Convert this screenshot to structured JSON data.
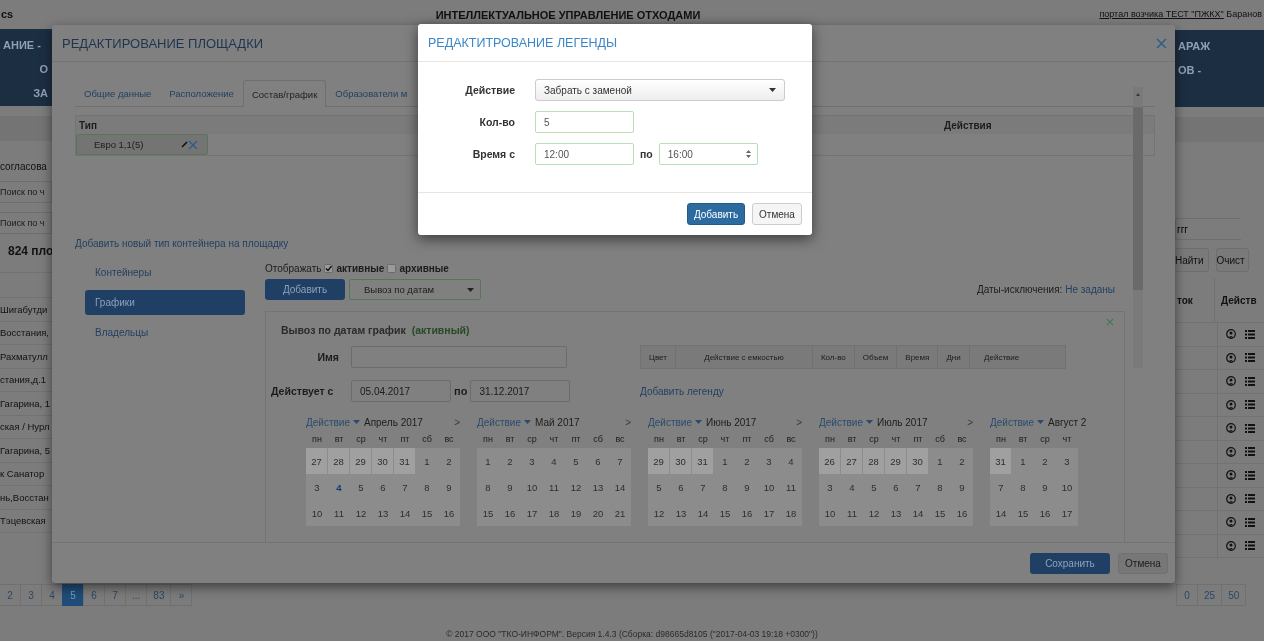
{
  "background": {
    "header": {
      "logo": "cs",
      "title": "ИНТЕЛЛЕКТУАЛЬНОЕ УПРАВЛЕНИЕ ОТХОДАМИ",
      "portal_link": "портал возчика ТЕСТ \"ПЖКХ\"",
      "user": "Баранов"
    },
    "nav_left": [
      "АНИЕ -",
      "О",
      "ЗА"
    ],
    "nav_right": [
      "АРАЖ",
      "ОВ -"
    ],
    "status_text": "согласова",
    "search_fields": [
      {
        "placeholder": "Поиск по ч"
      },
      {
        "placeholder": "Поиск по ч"
      }
    ],
    "count": "824 пло",
    "search_right": {
      "value": "ггг"
    },
    "buttons_right": [
      "Найти",
      "Очист"
    ],
    "columns_right": [
      "ток",
      "Действ"
    ],
    "rows": [
      "Шигабутди",
      "Восстания,",
      "Рахматулл",
      "стания,д.1",
      "Гагарина, 1",
      "ская / Нурл",
      "Гагарина, 5",
      "к Санатор",
      "нь,Восстан",
      "Тэцевская"
    ],
    "pagination": [
      {
        "label": "2",
        "selected": false
      },
      {
        "label": "3",
        "selected": false
      },
      {
        "label": "4",
        "selected": false
      },
      {
        "label": "5",
        "selected": true
      },
      {
        "label": "6",
        "selected": false
      },
      {
        "label": "7",
        "selected": false
      },
      {
        "label": "...",
        "selected": false
      },
      {
        "label": "83",
        "selected": false
      },
      {
        "label": "»",
        "selected": false
      }
    ],
    "page_sizes": [
      "0",
      "25",
      "50"
    ],
    "footer": "© 2017 ООО \"ТКО-ИНФОРМ\". Версия 1.4.3 (Сборка: d98665d8105 (\"2017-04-03 19:18 +0300\"))"
  },
  "site_modal": {
    "title": "РЕДАКТИРОВАНИЕ ПЛОЩАДКИ",
    "tabs": [
      {
        "label": "Общие данные",
        "selected": false
      },
      {
        "label": "Расположение",
        "selected": false
      },
      {
        "label": "Состав/график",
        "selected": true
      },
      {
        "label": "Образователи м",
        "selected": false
      }
    ],
    "container_table": {
      "columns": [
        "Тип",
        "Действия"
      ],
      "rows": [
        {
          "type": "Евро 1,1(5)",
          "selected": true
        }
      ]
    },
    "add_container_link": "Добавить новый тип контейнера на площадку",
    "side_nav": [
      {
        "label": "Контейнеры",
        "selected": false
      },
      {
        "label": "Графики",
        "selected": true
      },
      {
        "label": "Владельцы",
        "selected": false
      }
    ],
    "display_filter": {
      "label": "Отображать",
      "options": [
        {
          "label": "активные",
          "checked": true
        },
        {
          "label": "архивные",
          "checked": false
        }
      ]
    },
    "add_button": "Добавить",
    "schedule_type": "Вывоз по датам",
    "exclusions_label": "Даты-исключения:",
    "exclusions_link": "Не заданы",
    "schedule": {
      "title": "Вывоз по датам график",
      "status": "(активный)",
      "name_label": "Имя",
      "valid_label": "Действует с",
      "valid_from": "05.04.2017",
      "to_label": "по",
      "valid_to": "31.12.2017",
      "legend_columns": [
        "Цвет",
        "Действие с емкостью",
        "Кол-во",
        "Объем",
        "Время",
        "Дни",
        "Действие"
      ],
      "add_legend_link": "Добавить легенду",
      "calendars": [
        {
          "action": "Действие",
          "month": "Апрель 2017",
          "next": ">",
          "weekdays": [
            "пн",
            "вт",
            "ср",
            "чт",
            "пт",
            "сб",
            "вс"
          ],
          "weeks": [
            [
              {
                "day": "27",
                "outside": true,
                "today": false
              },
              {
                "day": "28",
                "outside": true,
                "today": false
              },
              {
                "day": "29",
                "outside": true,
                "today": false
              },
              {
                "day": "30",
                "outside": true,
                "today": false
              },
              {
                "day": "31",
                "outside": true,
                "today": false
              },
              {
                "day": "1",
                "outside": false,
                "today": false
              },
              {
                "day": "2",
                "outside": false,
                "today": false
              }
            ],
            [
              {
                "day": "3",
                "outside": false,
                "today": false
              },
              {
                "day": "4",
                "outside": false,
                "today": true
              },
              {
                "day": "5",
                "outside": false,
                "today": false
              },
              {
                "day": "6",
                "outside": false,
                "today": false
              },
              {
                "day": "7",
                "outside": false,
                "today": false
              },
              {
                "day": "8",
                "outside": false,
                "today": false
              },
              {
                "day": "9",
                "outside": false,
                "today": false
              }
            ],
            [
              {
                "day": "10",
                "outside": false,
                "today": false
              },
              {
                "day": "11",
                "outside": false,
                "today": false
              },
              {
                "day": "12",
                "outside": false,
                "today": false
              },
              {
                "day": "13",
                "outside": false,
                "today": false
              },
              {
                "day": "14",
                "outside": false,
                "today": false
              },
              {
                "day": "15",
                "outside": false,
                "today": false
              },
              {
                "day": "16",
                "outside": false,
                "today": false
              }
            ]
          ]
        },
        {
          "action": "Действие",
          "month": "Май 2017",
          "next": ">",
          "weekdays": [
            "пн",
            "вт",
            "ср",
            "чт",
            "пт",
            "сб",
            "вс"
          ],
          "weeks": [
            [
              {
                "day": "1",
                "outside": false,
                "today": false
              },
              {
                "day": "2",
                "outside": false,
                "today": false
              },
              {
                "day": "3",
                "outside": false,
                "today": false
              },
              {
                "day": "4",
                "outside": false,
                "today": false
              },
              {
                "day": "5",
                "outside": false,
                "today": false
              },
              {
                "day": "6",
                "outside": false,
                "today": false
              },
              {
                "day": "7",
                "outside": false,
                "today": false
              }
            ],
            [
              {
                "day": "8",
                "outside": false,
                "today": false
              },
              {
                "day": "9",
                "outside": false,
                "today": false
              },
              {
                "day": "10",
                "outside": false,
                "today": false
              },
              {
                "day": "11",
                "outside": false,
                "today": false
              },
              {
                "day": "12",
                "outside": false,
                "today": false
              },
              {
                "day": "13",
                "outside": false,
                "today": false
              },
              {
                "day": "14",
                "outside": false,
                "today": false
              }
            ],
            [
              {
                "day": "15",
                "outside": false,
                "today": false
              },
              {
                "day": "16",
                "outside": false,
                "today": false
              },
              {
                "day": "17",
                "outside": false,
                "today": false
              },
              {
                "day": "18",
                "outside": false,
                "today": false
              },
              {
                "day": "19",
                "outside": false,
                "today": false
              },
              {
                "day": "20",
                "outside": false,
                "today": false
              },
              {
                "day": "21",
                "outside": false,
                "today": false
              }
            ]
          ]
        },
        {
          "action": "Действие",
          "month": "Июнь 2017",
          "next": ">",
          "weekdays": [
            "пн",
            "вт",
            "ср",
            "чт",
            "пт",
            "сб",
            "вс"
          ],
          "weeks": [
            [
              {
                "day": "29",
                "outside": true,
                "today": false
              },
              {
                "day": "30",
                "outside": true,
                "today": false
              },
              {
                "day": "31",
                "outside": true,
                "today": false
              },
              {
                "day": "1",
                "outside": false,
                "today": false
              },
              {
                "day": "2",
                "outside": false,
                "today": false
              },
              {
                "day": "3",
                "outside": false,
                "today": false
              },
              {
                "day": "4",
                "outside": false,
                "today": false
              }
            ],
            [
              {
                "day": "5",
                "outside": false,
                "today": false
              },
              {
                "day": "6",
                "outside": false,
                "today": false
              },
              {
                "day": "7",
                "outside": false,
                "today": false
              },
              {
                "day": "8",
                "outside": false,
                "today": false
              },
              {
                "day": "9",
                "outside": false,
                "today": false
              },
              {
                "day": "10",
                "outside": false,
                "today": false
              },
              {
                "day": "11",
                "outside": false,
                "today": false
              }
            ],
            [
              {
                "day": "12",
                "outside": false,
                "today": false
              },
              {
                "day": "13",
                "outside": false,
                "today": false
              },
              {
                "day": "14",
                "outside": false,
                "today": false
              },
              {
                "day": "15",
                "outside": false,
                "today": false
              },
              {
                "day": "16",
                "outside": false,
                "today": false
              },
              {
                "day": "17",
                "outside": false,
                "today": false
              },
              {
                "day": "18",
                "outside": false,
                "today": false
              }
            ]
          ]
        },
        {
          "action": "Действие",
          "month": "Июль 2017",
          "next": ">",
          "weekdays": [
            "пн",
            "вт",
            "ср",
            "чт",
            "пт",
            "сб",
            "вс"
          ],
          "weeks": [
            [
              {
                "day": "26",
                "outside": true,
                "today": false
              },
              {
                "day": "27",
                "outside": true,
                "today": false
              },
              {
                "day": "28",
                "outside": true,
                "today": false
              },
              {
                "day": "29",
                "outside": true,
                "today": false
              },
              {
                "day": "30",
                "outside": true,
                "today": false
              },
              {
                "day": "1",
                "outside": false,
                "today": false
              },
              {
                "day": "2",
                "outside": false,
                "today": false
              }
            ],
            [
              {
                "day": "3",
                "outside": false,
                "today": false
              },
              {
                "day": "4",
                "outside": false,
                "today": false
              },
              {
                "day": "5",
                "outside": false,
                "today": false
              },
              {
                "day": "6",
                "outside": false,
                "today": false
              },
              {
                "day": "7",
                "outside": false,
                "today": false
              },
              {
                "day": "8",
                "outside": false,
                "today": false
              },
              {
                "day": "9",
                "outside": false,
                "today": false
              }
            ],
            [
              {
                "day": "10",
                "outside": false,
                "today": false
              },
              {
                "day": "11",
                "outside": false,
                "today": false
              },
              {
                "day": "12",
                "outside": false,
                "today": false
              },
              {
                "day": "13",
                "outside": false,
                "today": false
              },
              {
                "day": "14",
                "outside": false,
                "today": false
              },
              {
                "day": "15",
                "outside": false,
                "today": false
              },
              {
                "day": "16",
                "outside": false,
                "today": false
              }
            ]
          ]
        },
        {
          "action": "Действие",
          "month": "Август 2",
          "weekdays": [
            "пн",
            "вт",
            "ср",
            "чт"
          ],
          "weeks": [
            [
              {
                "day": "31",
                "outside": true,
                "today": false
              },
              {
                "day": "1",
                "outside": false,
                "today": false
              },
              {
                "day": "2",
                "outside": false,
                "today": false
              },
              {
                "day": "3",
                "outside": false,
                "today": false
              }
            ],
            [
              {
                "day": "7",
                "outside": false,
                "today": false
              },
              {
                "day": "8",
                "outside": false,
                "today": false
              },
              {
                "day": "9",
                "outside": false,
                "today": false
              },
              {
                "day": "10",
                "outside": false,
                "today": false
              }
            ],
            [
              {
                "day": "14",
                "outside": false,
                "today": false
              },
              {
                "day": "15",
                "outside": false,
                "today": false
              },
              {
                "day": "16",
                "outside": false,
                "today": false
              },
              {
                "day": "17",
                "outside": false,
                "today": false
              }
            ]
          ]
        }
      ]
    },
    "buttons": [
      "Сохранить",
      "Отмена"
    ]
  },
  "legend_modal": {
    "title": "РЕДАКТИТРОВАНИЕ ЛЕГЕНДЫ",
    "fields": [
      {
        "kind": "select",
        "label": "Действие",
        "value": "Забрать с заменой"
      },
      {
        "kind": "text",
        "label": "Кол-во",
        "value": "5"
      },
      {
        "kind": "time_range",
        "label": "Время с",
        "from": "12:00",
        "to_label": "по",
        "to": "16:00"
      }
    ],
    "buttons": [
      "Добавить",
      "Отмена"
    ]
  }
}
